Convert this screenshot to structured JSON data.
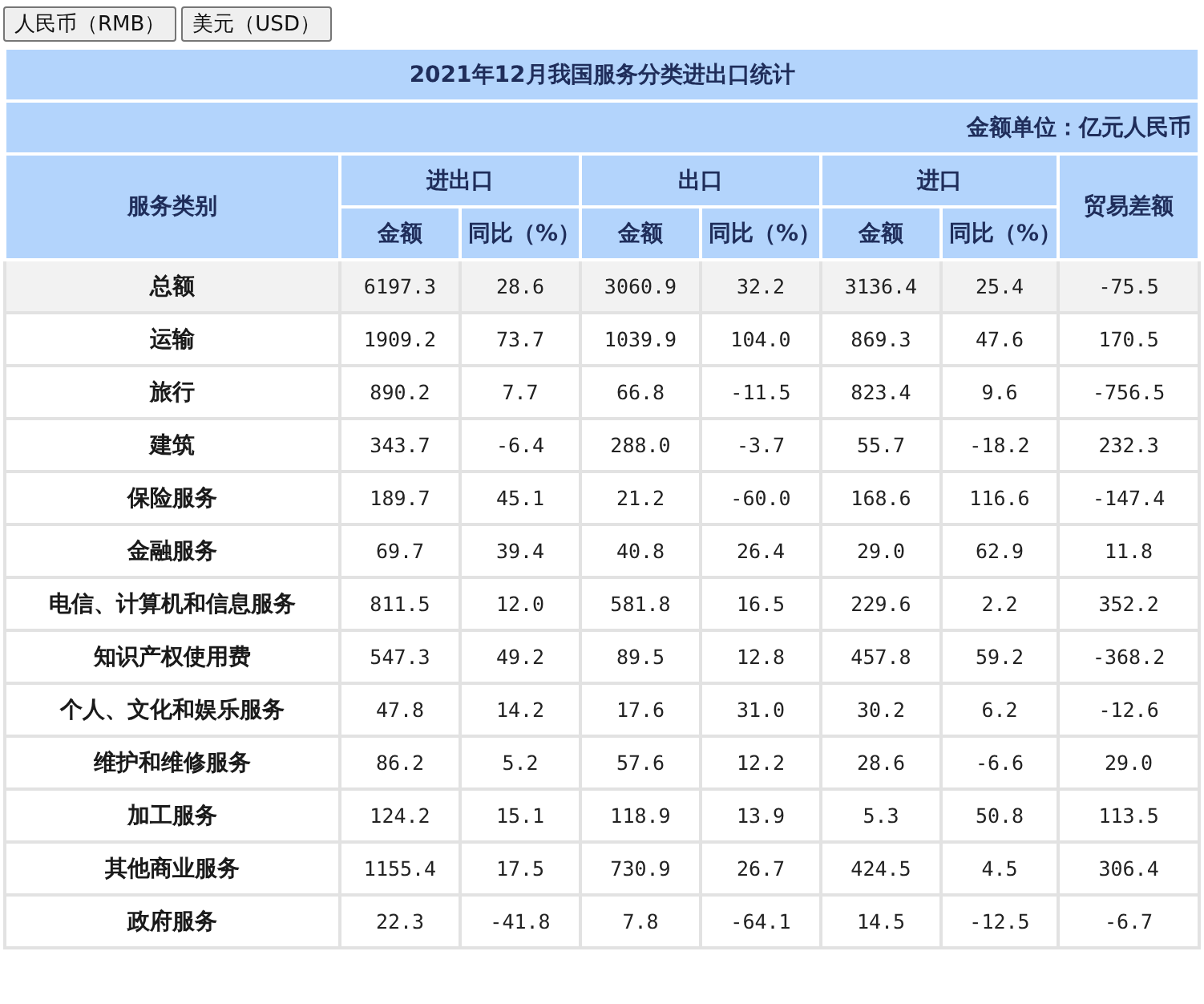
{
  "currency_buttons": [
    "人民币（RMB）",
    "美元（USD）"
  ],
  "table": {
    "title": "2021年12月我国服务分类进出口统计",
    "unit": "金额单位：亿元人民币",
    "columns": {
      "category": "服务类别",
      "groups": [
        {
          "label": "进出口",
          "sub": [
            "金额",
            "同比（%）"
          ]
        },
        {
          "label": "出口",
          "sub": [
            "金额",
            "同比（%）"
          ]
        },
        {
          "label": "进口",
          "sub": [
            "金额",
            "同比（%）"
          ]
        }
      ],
      "balance": "贸易差额"
    },
    "rows": [
      {
        "kind": "total",
        "name": "总额",
        "values": [
          "6197.3",
          "28.6",
          "3060.9",
          "32.2",
          "3136.4",
          "25.4",
          "-75.5"
        ]
      },
      {
        "kind": "item",
        "name": "运输",
        "values": [
          "1909.2",
          "73.7",
          "1039.9",
          "104.0",
          "869.3",
          "47.6",
          "170.5"
        ]
      },
      {
        "kind": "item",
        "name": "旅行",
        "values": [
          "890.2",
          "7.7",
          "66.8",
          "-11.5",
          "823.4",
          "9.6",
          "-756.5"
        ]
      },
      {
        "kind": "item",
        "name": "建筑",
        "values": [
          "343.7",
          "-6.4",
          "288.0",
          "-3.7",
          "55.7",
          "-18.2",
          "232.3"
        ]
      },
      {
        "kind": "item",
        "name": "保险服务",
        "values": [
          "189.7",
          "45.1",
          "21.2",
          "-60.0",
          "168.6",
          "116.6",
          "-147.4"
        ]
      },
      {
        "kind": "item",
        "name": "金融服务",
        "values": [
          "69.7",
          "39.4",
          "40.8",
          "26.4",
          "29.0",
          "62.9",
          "11.8"
        ]
      },
      {
        "kind": "item",
        "name": "电信、计算机和信息服务",
        "values": [
          "811.5",
          "12.0",
          "581.8",
          "16.5",
          "229.6",
          "2.2",
          "352.2"
        ]
      },
      {
        "kind": "item",
        "name": "知识产权使用费",
        "values": [
          "547.3",
          "49.2",
          "89.5",
          "12.8",
          "457.8",
          "59.2",
          "-368.2"
        ]
      },
      {
        "kind": "item",
        "name": "个人、文化和娱乐服务",
        "values": [
          "47.8",
          "14.2",
          "17.6",
          "31.0",
          "30.2",
          "6.2",
          "-12.6"
        ]
      },
      {
        "kind": "item",
        "name": "维护和维修服务",
        "values": [
          "86.2",
          "5.2",
          "57.6",
          "12.2",
          "28.6",
          "-6.6",
          "29.0"
        ]
      },
      {
        "kind": "item",
        "name": "加工服务",
        "values": [
          "124.2",
          "15.1",
          "118.9",
          "13.9",
          "5.3",
          "50.8",
          "113.5"
        ]
      },
      {
        "kind": "item",
        "name": "其他商业服务",
        "values": [
          "1155.4",
          "17.5",
          "730.9",
          "26.7",
          "424.5",
          "4.5",
          "306.4"
        ]
      },
      {
        "kind": "item",
        "name": "政府服务",
        "values": [
          "22.3",
          "-41.8",
          "7.8",
          "-64.1",
          "14.5",
          "-12.5",
          "-6.7"
        ]
      }
    ]
  }
}
